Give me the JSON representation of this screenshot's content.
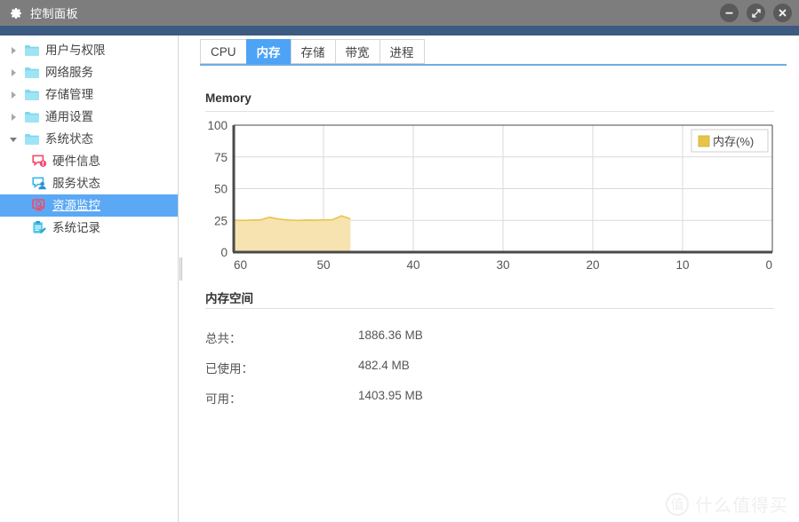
{
  "window": {
    "title": "控制面板",
    "gear_icon": "gear-icon",
    "buttons": {
      "minimize": "minimize-icon",
      "maximize": "maximize-icon",
      "close": "close-icon"
    }
  },
  "sidebar": {
    "items": [
      {
        "label": "用户与权限",
        "level": 1,
        "icon": "folder-icon",
        "expanded": false,
        "selected": false
      },
      {
        "label": "网络服务",
        "level": 1,
        "icon": "folder-icon",
        "expanded": false,
        "selected": false
      },
      {
        "label": "存储管理",
        "level": 1,
        "icon": "folder-icon",
        "expanded": false,
        "selected": false
      },
      {
        "label": "通用设置",
        "level": 1,
        "icon": "folder-icon",
        "expanded": false,
        "selected": false
      },
      {
        "label": "系统状态",
        "level": 1,
        "icon": "folder-icon",
        "expanded": true,
        "selected": false
      },
      {
        "label": "硬件信息",
        "level": 2,
        "icon": "hardware-info-icon",
        "selected": false
      },
      {
        "label": "服务状态",
        "level": 2,
        "icon": "service-status-icon",
        "selected": false
      },
      {
        "label": "资源监控",
        "level": 2,
        "icon": "resource-monitor-icon",
        "selected": true
      },
      {
        "label": "系统记录",
        "level": 2,
        "icon": "system-log-icon",
        "selected": false
      }
    ]
  },
  "tabs": [
    {
      "label": "CPU",
      "active": false
    },
    {
      "label": "内存",
      "active": true
    },
    {
      "label": "存储",
      "active": false
    },
    {
      "label": "带宽",
      "active": false
    },
    {
      "label": "进程",
      "active": false
    }
  ],
  "memory_section": {
    "title": "Memory",
    "space_title": "内存空间",
    "stats": [
      {
        "label": "总共：",
        "value": "1886.36 MB"
      },
      {
        "label": "已使用：",
        "value": "482.4 MB"
      },
      {
        "label": "可用：",
        "value": "1403.95 MB"
      }
    ]
  },
  "colors": {
    "accent_blue": "#4da3f5",
    "title_bar": "#7d7d7d",
    "accent_bar": "#3d5a80",
    "series_fill": "#f7e3b0",
    "series_stroke": "#e8c34a",
    "axis": "#4a4a4a",
    "grid": "#d9d9d9"
  },
  "chart_data": {
    "type": "area",
    "title": "Memory",
    "xlabel": "",
    "ylabel": "",
    "legend": [
      {
        "name": "内存(%)",
        "color": "#e8c34a"
      }
    ],
    "legend_position": "top-right",
    "grid": true,
    "xlim": [
      60,
      0
    ],
    "ylim": [
      0,
      100
    ],
    "xticks": [
      60,
      50,
      40,
      30,
      20,
      10,
      0
    ],
    "yticks": [
      0,
      25,
      50,
      75,
      100
    ],
    "x_axis_direction": "descending",
    "series": [
      {
        "name": "内存(%)",
        "x": [
          60,
          59,
          58,
          57,
          56,
          55,
          54,
          53,
          52,
          51,
          50,
          49,
          48,
          47
        ],
        "values": [
          25.1,
          25.0,
          25.2,
          25.4,
          27.5,
          26.0,
          25.3,
          25.0,
          25.2,
          25.1,
          25.4,
          25.5,
          28.6,
          26.2
        ]
      }
    ]
  },
  "watermark": {
    "mark": "值",
    "text": "什么值得买"
  }
}
